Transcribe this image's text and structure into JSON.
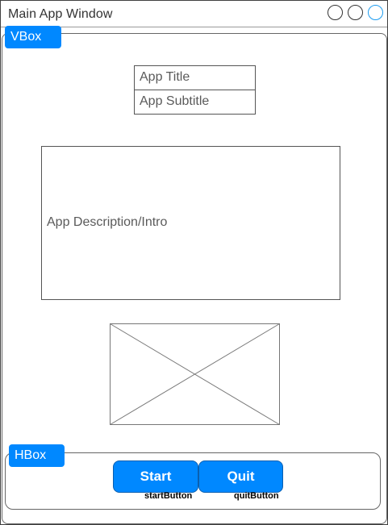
{
  "window": {
    "title": "Main  App  Window",
    "controls": [
      "circle-button",
      "circle-button",
      "circle-button-active"
    ],
    "accent_color": "#0088ff",
    "active_control_color": "#1c9cf0"
  },
  "layout_tags": {
    "vbox": "VBox",
    "hbox": "HBox"
  },
  "content": {
    "app_title": "App Title",
    "app_subtitle": "App Subtitle",
    "app_description": "App Description/Intro",
    "image_placeholder": "image-placeholder-icon"
  },
  "buttons": {
    "start_label": "Start",
    "start_id": "startButton",
    "quit_label": "Quit",
    "quit_id": "quitButton"
  }
}
